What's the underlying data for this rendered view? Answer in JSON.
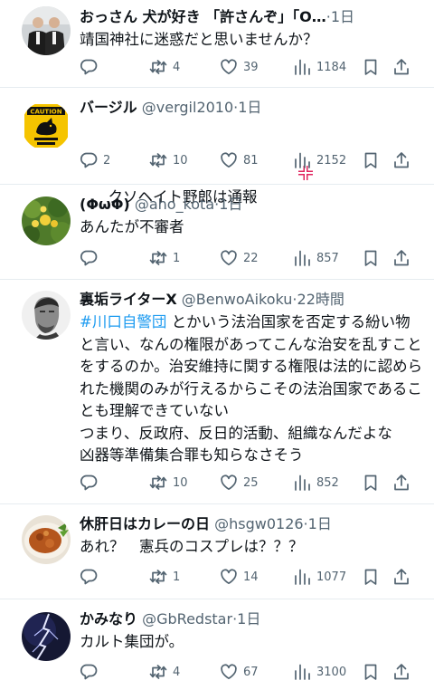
{
  "colors": {
    "text": "#0f1419",
    "muted": "#536471",
    "link": "#1d9bf0",
    "divider": "#e6ecf0",
    "emoji_red": "#e0245e"
  },
  "icons": [
    "reply-icon",
    "retweet-icon",
    "like-icon",
    "views-icon",
    "bookmark-icon",
    "share-icon",
    "anger-emoji-icon"
  ],
  "tweets": [
    {
      "name": "おっさん 犬が好き 「許さんぞ」「O…",
      "handle": "",
      "sep": "·",
      "time": "1日",
      "text": "靖国神社に迷惑だと思いませんか？",
      "replies": "",
      "retweets": "4",
      "likes": "39",
      "views": "1184"
    },
    {
      "name": "バージル",
      "handle": "@vergil2010",
      "sep": "·",
      "time": "1日",
      "text": "クソヘイト野郎は通報",
      "avatar_text": "CAUTION",
      "replies": "2",
      "retweets": "10",
      "likes": "81",
      "views": "2152"
    },
    {
      "name": "(ΦωΦ)",
      "handle": "@aho_kota",
      "sep": "·",
      "time": "1日",
      "text": "あんたが不審者",
      "replies": "",
      "retweets": "1",
      "likes": "22",
      "views": "857"
    },
    {
      "name": "裏垢ライターX",
      "handle": "@BenwoAikoku",
      "sep": "·",
      "time": "22時間",
      "hashtag": "#川口自警団",
      "text_after_hashtag": " とかいう法治国家を否定する紛い物と言い、なんの権限があってこんな治安を乱すことをするのか。治安維持に関する権限は法的に認められた機関のみが行えるからこその法治国家であることも理解できていない\nつまり、反政府、反日的活動、組織なんだよな\n凶器等準備集合罪も知らなさそう",
      "replies": "",
      "retweets": "10",
      "likes": "25",
      "views": "852"
    },
    {
      "name": "休肝日はカレーの日",
      "handle": "@hsgw0126",
      "sep": "·",
      "time": "1日",
      "text": "あれ？　憲兵のコスプレは？？？",
      "replies": "",
      "retweets": "1",
      "likes": "14",
      "views": "1077"
    },
    {
      "name": "かみなり",
      "handle": "@GbRedstar",
      "sep": "·",
      "time": "1日",
      "text": "カルト集団が。",
      "replies": "",
      "retweets": "4",
      "likes": "67",
      "views": "3100"
    }
  ]
}
